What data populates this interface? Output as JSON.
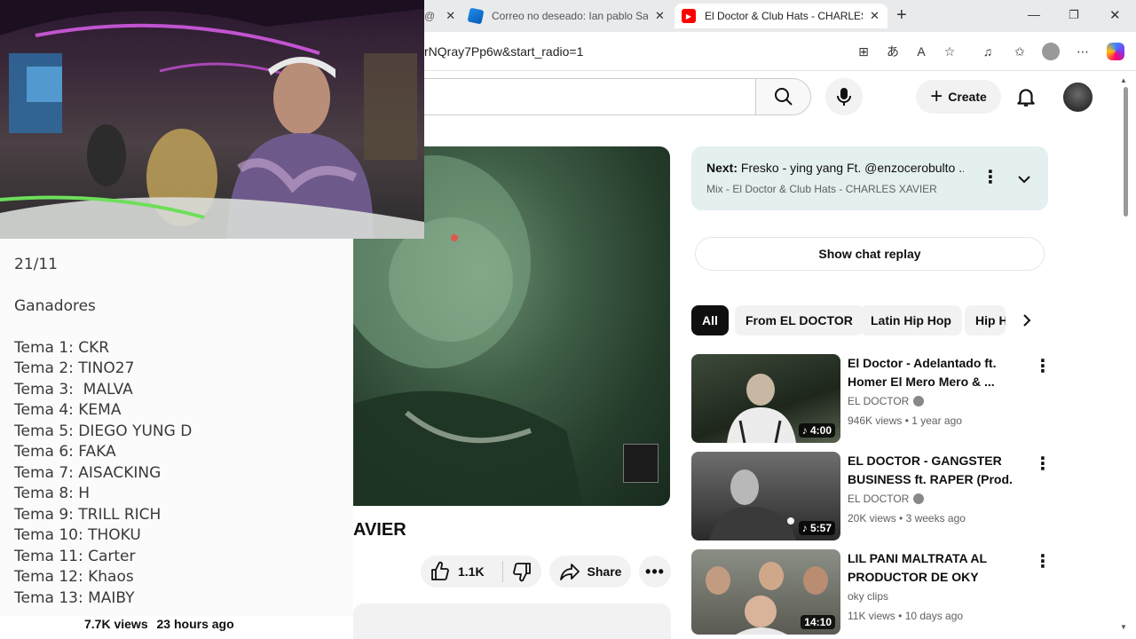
{
  "browser": {
    "tabs": [
      {
        "title": "@",
        "favicon": "mail-icon"
      },
      {
        "title": "Correo no deseado: Ian pablo Sal",
        "favicon": "outlook-icon"
      },
      {
        "title": "El Doctor & Club Hats - CHARLES",
        "favicon": "youtube-icon"
      }
    ],
    "url_fragment": "rNQray7Pp6w&start_radio=1"
  },
  "header": {
    "create_label": "Create"
  },
  "webcam": {
    "description_icon": "streamer-webcam"
  },
  "notes": {
    "date": "21/11",
    "heading": "Ganadores",
    "items": [
      "Tema 1: CKR",
      "Tema 2: TINO27",
      "Tema 3:  MALVA",
      "Tema 4: KEMA",
      "Tema 5: DIEGO YUNG D",
      "Tema 6: FAKA",
      "Tema 7: AISACKING",
      "Tema 8: H",
      "Tema 9: TRILL RICH",
      "Tema 10: THOKU",
      "Tema 11: Carter",
      "Tema 12: Khaos",
      "Tema 13: MAIBY"
    ]
  },
  "video": {
    "title_fragment": "AVIER",
    "like_count": "1.1K",
    "share_label": "Share",
    "views": "7.7K views",
    "age": "23 hours ago"
  },
  "next_up": {
    "label": "Next:",
    "title": "Fresko - ying yang Ft. @enzocerobulto ...",
    "mix": "Mix - El Doctor & Club Hats - CHARLES XAVIER"
  },
  "chat": {
    "replay_label": "Show chat replay"
  },
  "chips": [
    "All",
    "From EL DOCTOR",
    "Latin Hip Hop",
    "Hip H"
  ],
  "recommendations": [
    {
      "title": "El Doctor - Adelantado ft. Homer El Mero Mero & ...",
      "channel": "EL DOCTOR",
      "verified": true,
      "views": "946K views",
      "age": "1 year ago",
      "duration": "4:00",
      "music_icon": true
    },
    {
      "title": "EL DOCTOR - GANGSTER BUSINESS ft. RAPER (Prod. ...",
      "channel": "EL DOCTOR",
      "verified": true,
      "views": "20K views",
      "age": "3 weeks ago",
      "duration": "5:57",
      "music_icon": true
    },
    {
      "title": "LIL PANI MALTRATA AL PRODUCTOR DE OKY",
      "channel": "oky clips",
      "verified": false,
      "views": "11K views",
      "age": "10 days ago",
      "duration": "14:10",
      "music_icon": false
    }
  ],
  "colors": {
    "youtube_red": "#ff0000",
    "chip_selected": "#0f0f0f",
    "next_card_bg": "#e4eff0"
  }
}
